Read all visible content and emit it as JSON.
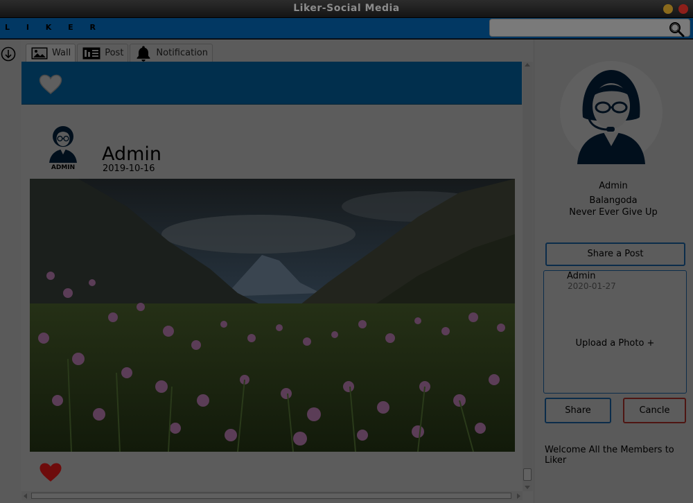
{
  "window": {
    "title": "Liker-Social Media"
  },
  "header": {
    "logo": "L I K E R",
    "search": {
      "value": "",
      "placeholder": "",
      "icon": "search-icon"
    }
  },
  "tabs": [
    {
      "label": "Wall",
      "icon": "image-icon",
      "active": true
    },
    {
      "label": "Post",
      "icon": "post-icon",
      "active": false
    },
    {
      "label": "Notification",
      "icon": "bell-icon",
      "active": false
    }
  ],
  "feed": {
    "banner_icon": "heart-outline-icon",
    "post": {
      "author": "Admin",
      "avatar_caption": "ADMIN",
      "date": "2019-10-16",
      "image": "mountain valley with pink wildflowers",
      "like_icon": "heart-icon"
    }
  },
  "profile": {
    "name": "Admin",
    "location": "Balangoda",
    "motto": "Never Ever Give Up"
  },
  "composer": {
    "share_post_label": "Share a Post",
    "author": "Admin",
    "date": "2020-01-27",
    "upload_label": "Upload a Photo +",
    "share_label": "Share",
    "cancel_label": "Cancle"
  },
  "welcome_text": "Welcome All the Members to Liker",
  "colors": {
    "header": "#023863",
    "banner": "#012f4d",
    "like_heart": "#6e0c0c",
    "button_border": "#0b2c4a",
    "cancel_border": "#4e1512"
  }
}
